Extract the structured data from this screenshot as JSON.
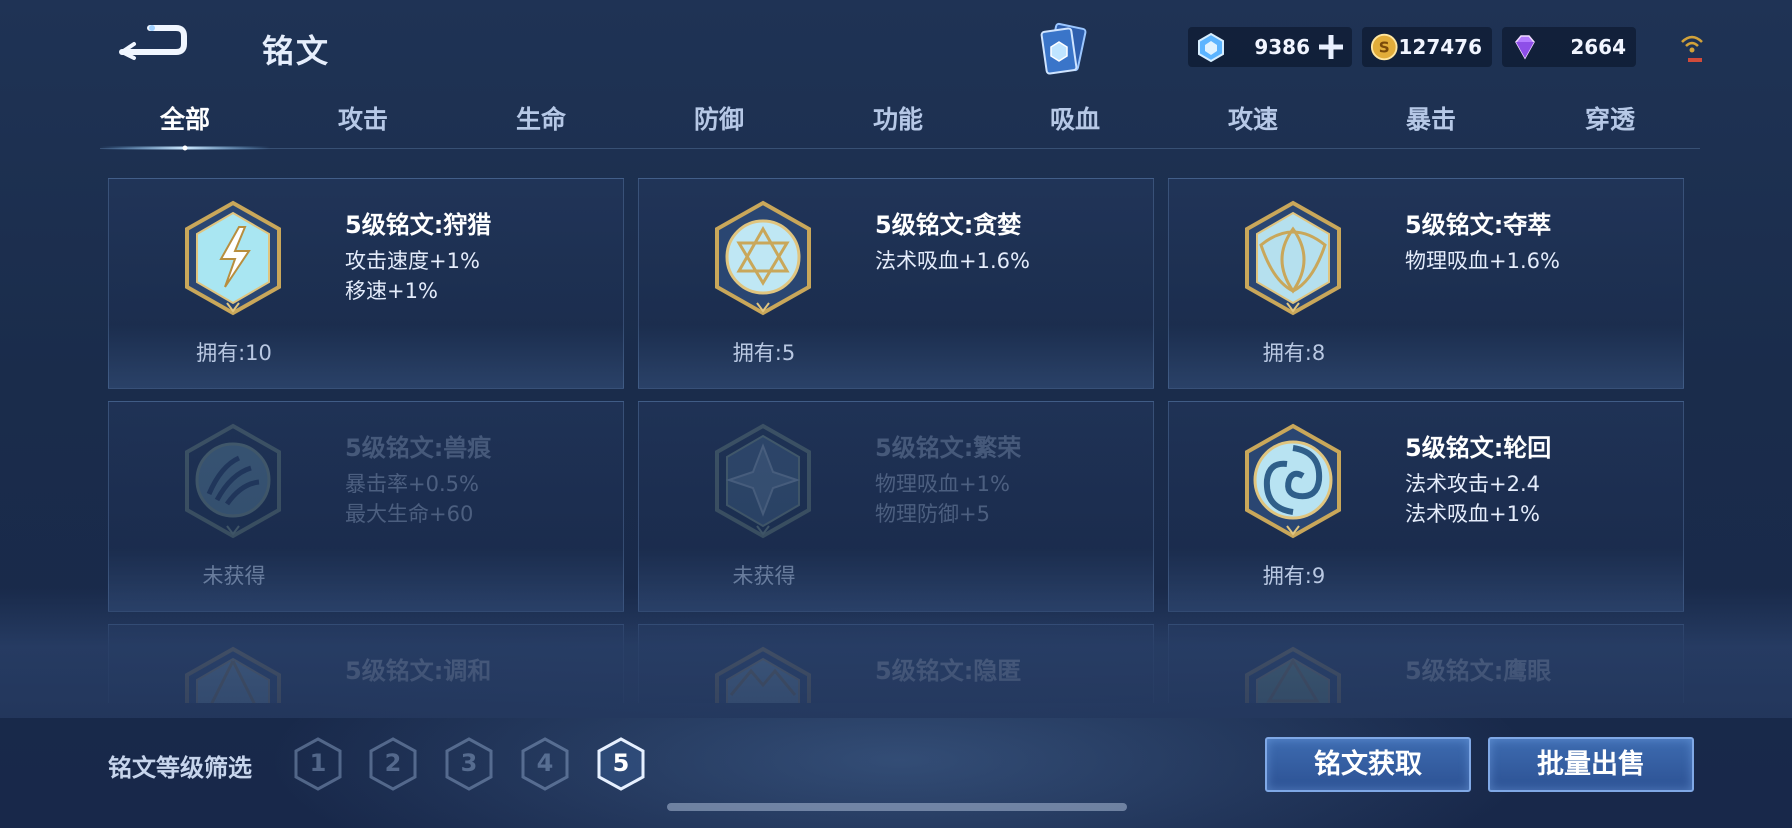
{
  "header": {
    "title": "铭文",
    "currencies": [
      {
        "icon": "hex-coupon-icon",
        "value": "9386"
      },
      {
        "icon": "gold-coin-icon",
        "value": "127476"
      },
      {
        "icon": "purple-diamond-icon",
        "value": "2664"
      }
    ]
  },
  "tabs": [
    "全部",
    "攻击",
    "生命",
    "防御",
    "功能",
    "吸血",
    "攻速",
    "暴击",
    "穿透"
  ],
  "active_tab": "全部",
  "cards": [
    {
      "name": "5级铭文:狩猎",
      "stat1": "攻击速度+1%",
      "stat2": "移速+1%",
      "owned": "拥有:10",
      "locked": false,
      "icon": "lightning-emblem-icon",
      "color": "#a9e6f2"
    },
    {
      "name": "5级铭文:贪婪",
      "stat1": "法术吸血+1.6%",
      "stat2": "",
      "owned": "拥有:5",
      "locked": false,
      "icon": "star-circle-emblem-icon",
      "color": "#bfe7f4"
    },
    {
      "name": "5级铭文:夺萃",
      "stat1": "物理吸血+1.6%",
      "stat2": "",
      "owned": "拥有:8",
      "locked": false,
      "icon": "knot-emblem-icon",
      "color": "#b5e0ee"
    },
    {
      "name": "5级铭文:兽痕",
      "stat1": "暴击率+0.5%",
      "stat2": "最大生命+60",
      "owned": "未获得",
      "locked": true,
      "icon": "claw-emblem-icon",
      "color": "#6fa0b8"
    },
    {
      "name": "5级铭文:繁荣",
      "stat1": "物理吸血+1%",
      "stat2": "物理防御+5",
      "owned": "未获得",
      "locked": true,
      "icon": "crystal-emblem-icon",
      "color": "#6f96b8"
    },
    {
      "name": "5级铭文:轮回",
      "stat1": "法术攻击+2.4",
      "stat2": "法术吸血+1%",
      "owned": "拥有:9",
      "locked": false,
      "icon": "swirl-emblem-icon",
      "color": "#b8e3f2"
    },
    {
      "name": "5级铭文:调和",
      "stat1": "",
      "stat2": "",
      "owned": "",
      "locked": false,
      "icon": "peak-emblem-icon",
      "color": "#a8d6e6"
    },
    {
      "name": "5级铭文:隐匿",
      "stat1": "",
      "stat2": "",
      "owned": "",
      "locked": false,
      "icon": "mountain-emblem-icon",
      "color": "#a8d6e6"
    },
    {
      "name": "5级铭文:鹰眼",
      "stat1": "",
      "stat2": "",
      "owned": "",
      "locked": false,
      "icon": "eye-emblem-icon",
      "color": "#a5d9a2"
    }
  ],
  "filter": {
    "label": "铭文等级筛选",
    "levels": [
      "1",
      "2",
      "3",
      "4",
      "5"
    ],
    "active_level": "5"
  },
  "actions": {
    "acquire_label": "铭文获取",
    "bulk_sell_label": "批量出售"
  }
}
